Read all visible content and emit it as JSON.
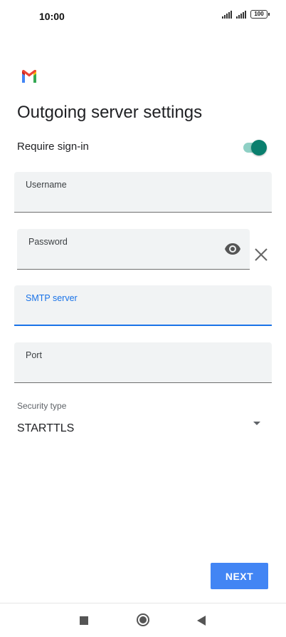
{
  "status_bar": {
    "time": "10:00",
    "battery": "100"
  },
  "logo": {
    "icon": "gmail-icon"
  },
  "page": {
    "title": "Outgoing server settings"
  },
  "require_signin": {
    "label": "Require sign-in",
    "enabled": true,
    "accent_color": "#0a7f6e"
  },
  "fields": {
    "username": {
      "label": "Username",
      "value": ""
    },
    "password": {
      "label": "Password",
      "value": ""
    },
    "smtp_server": {
      "label": "SMTP server",
      "value": "",
      "focused": true
    },
    "port": {
      "label": "Port",
      "value": ""
    }
  },
  "security": {
    "label": "Security type",
    "selected": "STARTTLS"
  },
  "actions": {
    "next_label": "NEXT",
    "next_color": "#4285f4"
  },
  "nav_bar": {
    "icons": [
      "recents-square-icon",
      "home-circle-icon",
      "back-triangle-icon"
    ]
  }
}
